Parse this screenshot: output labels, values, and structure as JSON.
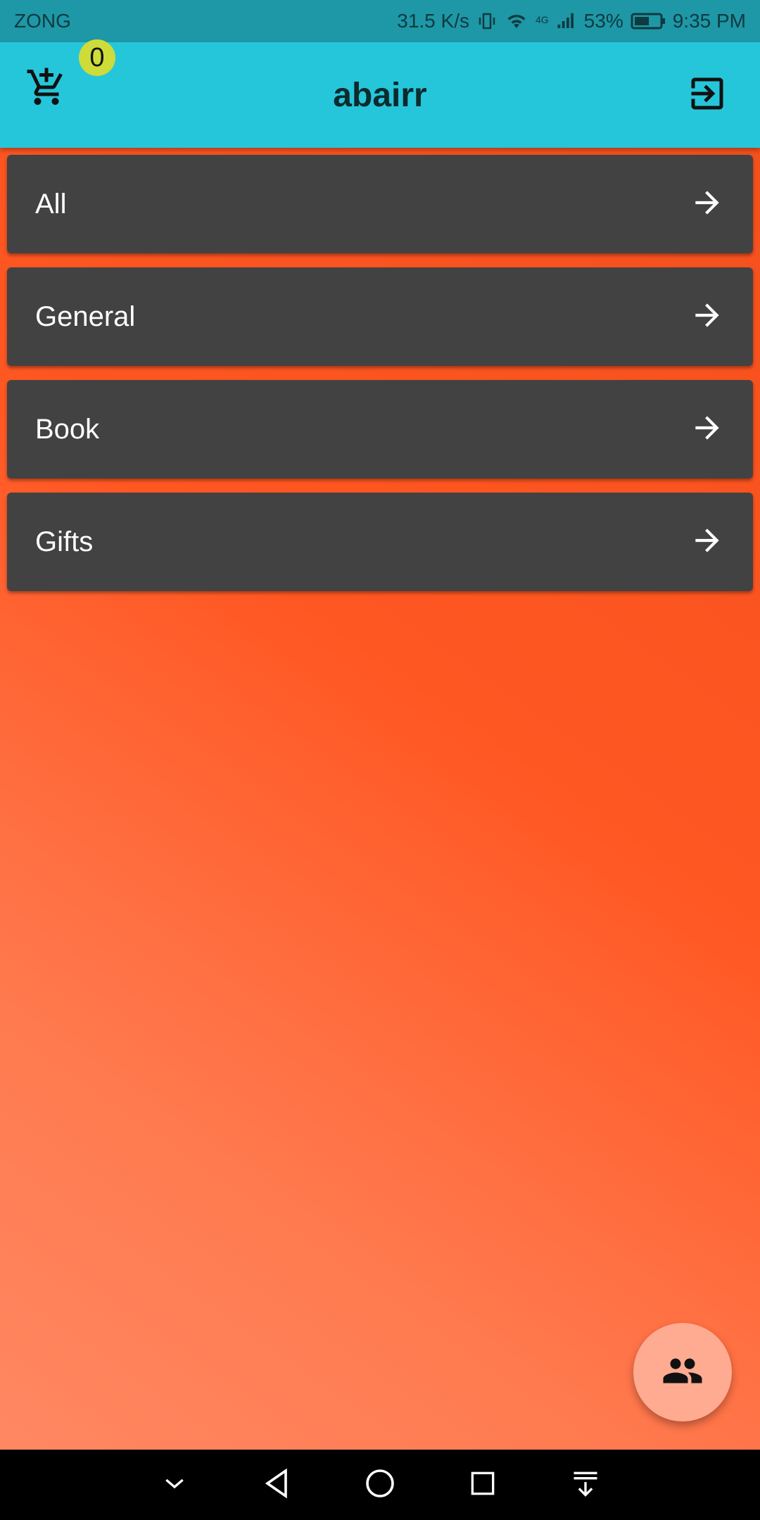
{
  "status_bar": {
    "carrier": "ZONG",
    "net_speed": "31.5 K/s",
    "network_type": "4G",
    "battery": "53%",
    "time": "9:35 PM",
    "icons": [
      "vibrate-icon",
      "wifi-icon",
      "signal-icon",
      "battery-icon"
    ]
  },
  "app_bar": {
    "title": "abairr",
    "cart_count": "0",
    "cart_icon": "add-shopping-cart-icon",
    "logout_icon": "logout-icon"
  },
  "categories": [
    {
      "label": "All",
      "icon": "arrow-right-icon"
    },
    {
      "label": "General",
      "icon": "arrow-right-icon"
    },
    {
      "label": "Book",
      "icon": "arrow-right-icon"
    },
    {
      "label": "Gifts",
      "icon": "arrow-right-icon"
    }
  ],
  "fab": {
    "icon": "people-icon"
  },
  "nav_bar": {
    "icons": [
      "collapse-icon",
      "back-icon",
      "home-icon",
      "recents-icon",
      "notification-pull-icon"
    ]
  },
  "colors": {
    "status_bar": "#1e97a6",
    "app_bar": "#26c6da",
    "badge": "#cddc39",
    "card": "#424242",
    "background_top": "#ff5722",
    "background_bottom": "#ff8a65",
    "fab": "#ffab91"
  }
}
